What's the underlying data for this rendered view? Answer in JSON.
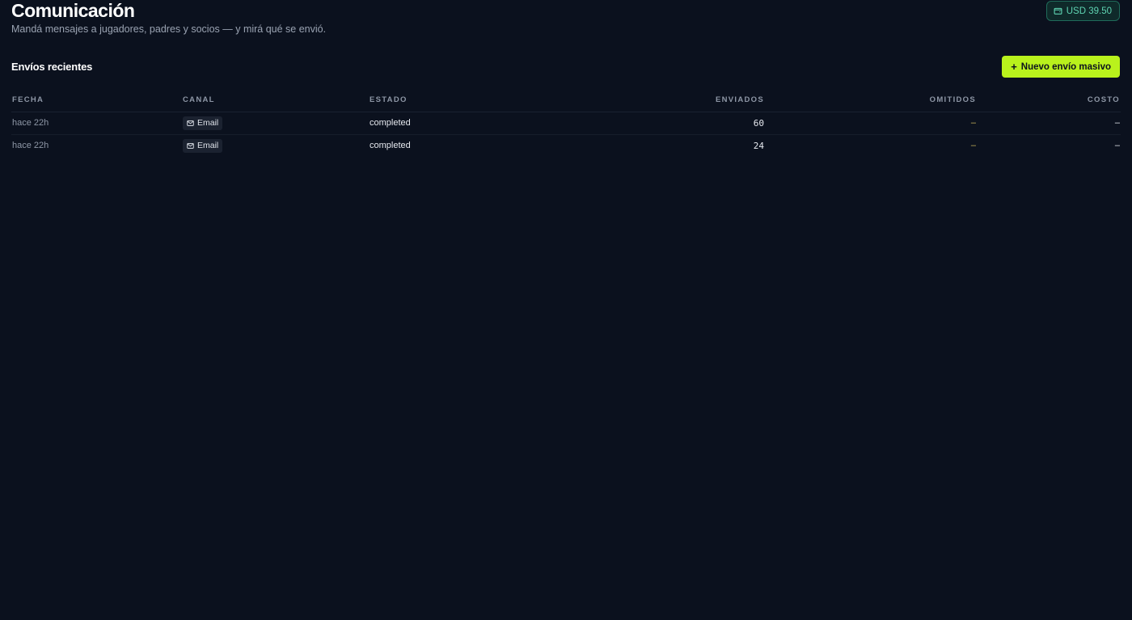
{
  "header": {
    "title": "Comunicación",
    "subtitle": "Mandá mensajes a jugadores, padres y socios — y mirá qué se envió.",
    "balance": "USD 39.50",
    "balance_icon": "wallet-icon"
  },
  "recent": {
    "title": "Envíos recientes",
    "new_send_label": "Nuevo envío masivo",
    "new_send_icon": "plus-icon",
    "columns": [
      "FECHA",
      "CANAL",
      "ESTADO",
      "ENVIADOS",
      "OMITIDOS",
      "COSTO"
    ],
    "rows": [
      {
        "date": "hace 22h",
        "channel": "Email",
        "channel_icon": "mail-icon",
        "status": "completed",
        "sent": "60",
        "omitted": "–",
        "cost": "–"
      },
      {
        "date": "hace 22h",
        "channel": "Email",
        "channel_icon": "mail-icon",
        "status": "completed",
        "sent": "24",
        "omitted": "–",
        "cost": "–"
      }
    ]
  },
  "colors": {
    "background": "#0b111e",
    "accent": "#b9f21c",
    "balance_text": "#5fd4b2",
    "omitted": "#c7b25a"
  }
}
